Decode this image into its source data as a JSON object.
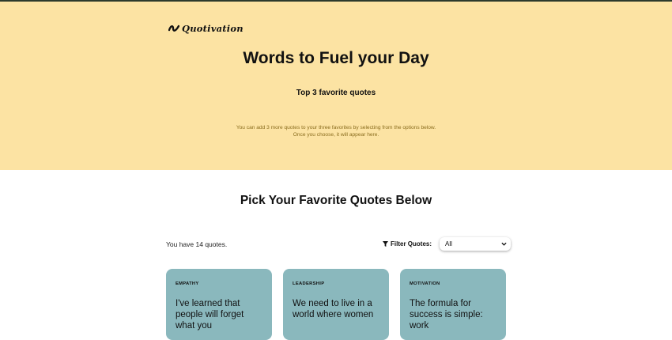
{
  "brand": {
    "logo_text": "Quotivation",
    "logo_icon": "swoosh-icon"
  },
  "hero": {
    "title": "Words to Fuel your Day",
    "subtitle": "Top 3 favorite quotes",
    "note_line1": "You can add 3 more quotes to your three favorites by selecting from the options below.",
    "note_line2": "Once you choose, it will appear here."
  },
  "section": {
    "title": "Pick Your Favorite Quotes Below"
  },
  "quotes_info": {
    "count_text": "You have 14 quotes."
  },
  "filter": {
    "label": "Filter Quotes:",
    "icon": "funnel-icon",
    "selected": "All"
  },
  "cards": [
    {
      "category": "EMPATHY",
      "quote": "I've learned that people will forget what you"
    },
    {
      "category": "LEADERSHIP",
      "quote": "We need to live in a world where women"
    },
    {
      "category": "MOTIVATION",
      "quote": "The formula for success is simple: work"
    }
  ],
  "colors": {
    "hero_bg": "#fce3a3",
    "card_bg": "#8ab8bd",
    "note_text": "#8a6d1e"
  }
}
